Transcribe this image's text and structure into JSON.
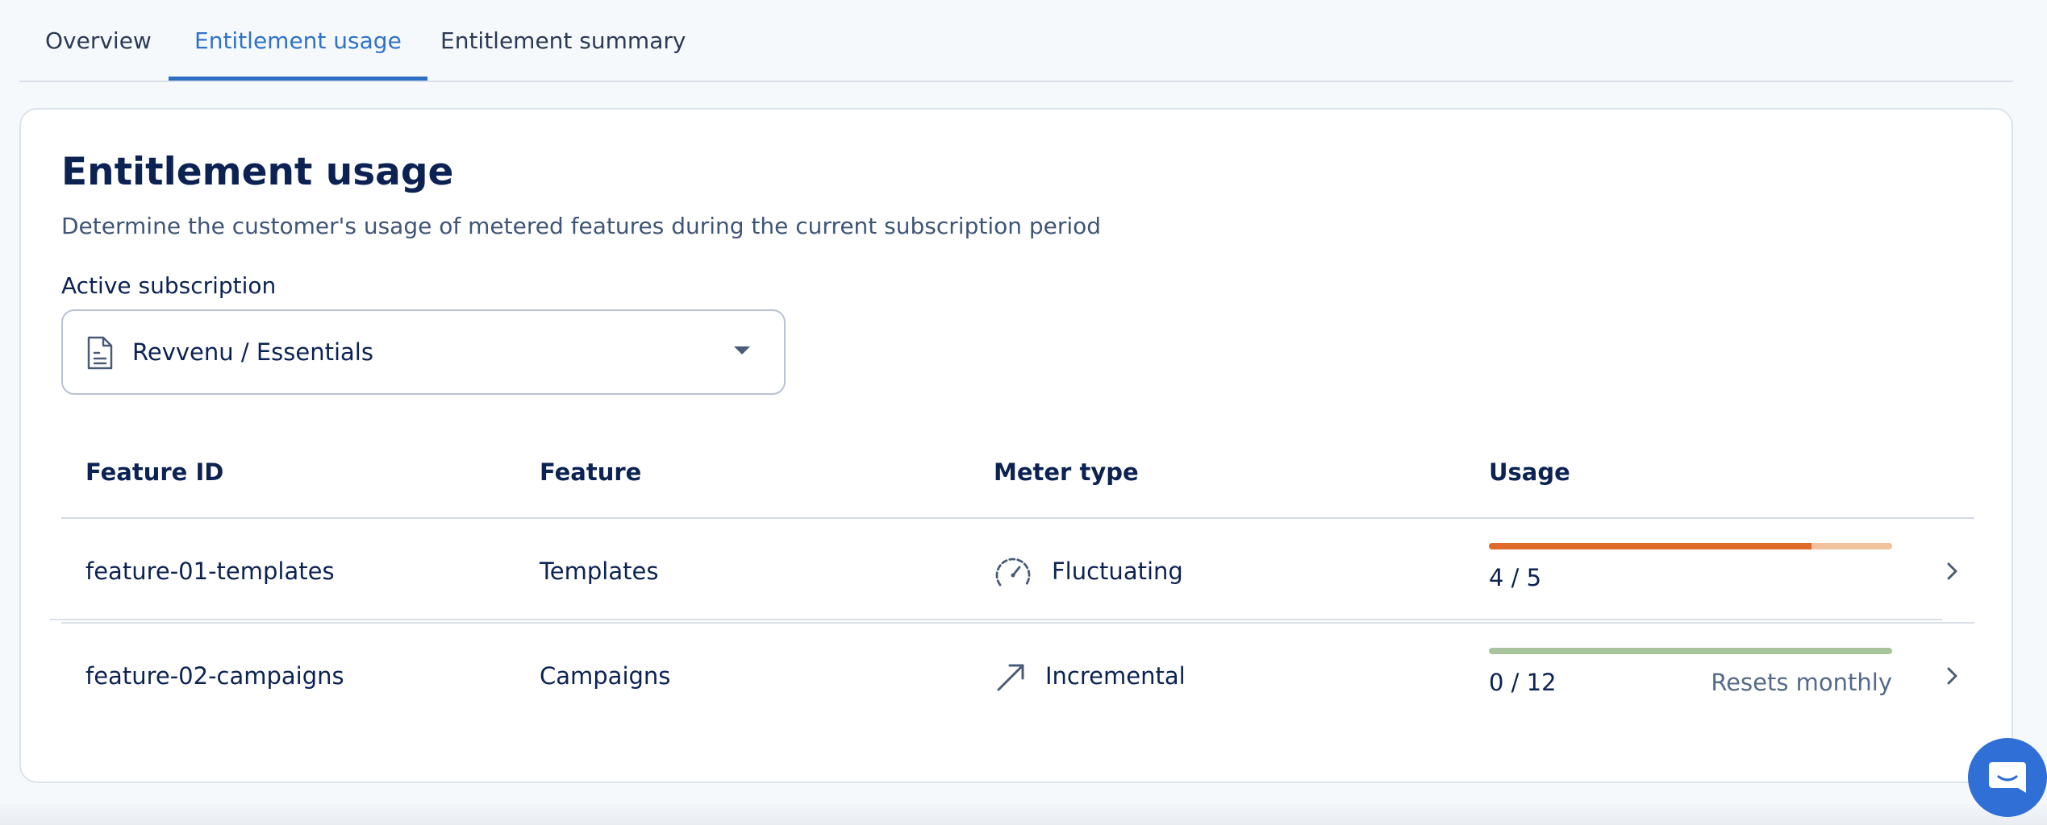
{
  "tabs": [
    {
      "label": "Overview",
      "active": false
    },
    {
      "label": "Entitlement usage",
      "active": true
    },
    {
      "label": "Entitlement summary",
      "active": false
    }
  ],
  "page": {
    "title": "Entitlement usage",
    "subtitle": "Determine the customer's usage of metered features during the current subscription period"
  },
  "subscription": {
    "label": "Active subscription",
    "value": "Revvenu / Essentials",
    "icon": "document-icon"
  },
  "table": {
    "headers": [
      "Feature ID",
      "Feature",
      "Meter type",
      "Usage"
    ],
    "rows": [
      {
        "feature_id": "feature-01-templates",
        "feature": "Templates",
        "meter_type": "Fluctuating",
        "meter_icon": "gauge-icon",
        "usage": "4 / 5",
        "usage_fraction": 0.8,
        "bar_color": "#e06a2c",
        "bar_track_color": "#f2c29e",
        "note": ""
      },
      {
        "feature_id": "feature-02-campaigns",
        "feature": "Campaigns",
        "meter_type": "Incremental",
        "meter_icon": "arrow-up-right-icon",
        "usage": "0 / 12",
        "usage_fraction": 0,
        "bar_color": "#a8c49c",
        "bar_track_color": "#a8c49c",
        "note": "Resets monthly"
      }
    ]
  },
  "colors": {
    "accent": "#2f72c9",
    "text": "#0b2253",
    "chat_button": "#2f6fd6"
  }
}
